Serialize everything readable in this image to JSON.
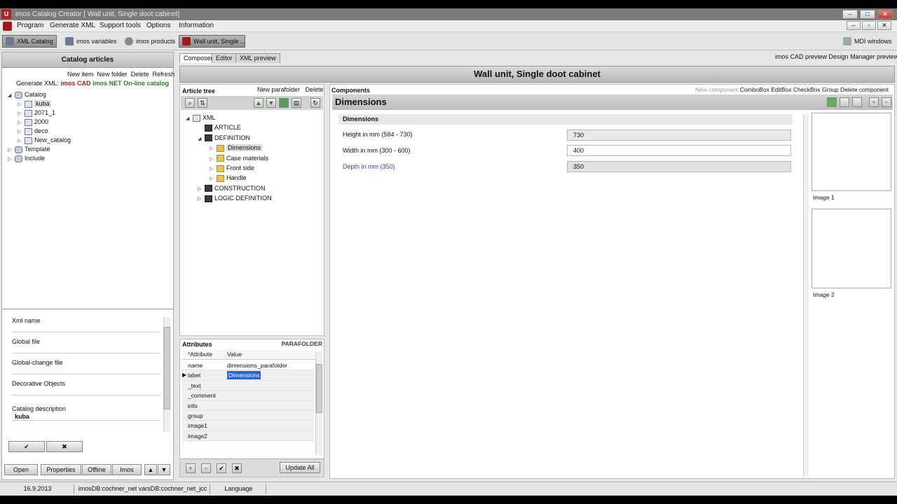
{
  "window": {
    "title": "imos Catalog Creator [ Wall unit, Single doot cabinet]",
    "icon_text": "U",
    "buttons": [
      "–",
      "□",
      "✕"
    ]
  },
  "menubar": {
    "items": [
      "Program",
      "Generate XML",
      "Support tools",
      "Options",
      "Information"
    ],
    "mdi_buttons": [
      "–",
      "▫",
      "✕"
    ]
  },
  "toolbar": {
    "buttons": [
      "XML Catalog",
      "imos variables",
      "imos products"
    ],
    "doc_tab": "Wall unit, Single ...",
    "mdi_windows": "MDI windows"
  },
  "left": {
    "header": "Catalog articles",
    "actions": [
      "New item",
      "New folder",
      "Delete",
      "Refresh"
    ],
    "generate_label": "Generate XML:",
    "generate_targets": [
      "imos CAD",
      "imos NET",
      "On-line catalog"
    ],
    "tree": [
      {
        "label": "Catalog",
        "level": 0,
        "icon": "db",
        "exp": "◢"
      },
      {
        "label": "kuba",
        "level": 1,
        "icon": "xml",
        "exp": "▷",
        "selected": true
      },
      {
        "label": "2071_1",
        "level": 1,
        "icon": "xml",
        "exp": "▷"
      },
      {
        "label": "2000",
        "level": 1,
        "icon": "xml",
        "exp": "▷"
      },
      {
        "label": "deco",
        "level": 1,
        "icon": "xml",
        "exp": "▷"
      },
      {
        "label": "New_catalog",
        "level": 1,
        "icon": "xml",
        "exp": "▷"
      },
      {
        "label": "Template",
        "level": 0,
        "icon": "db",
        "exp": "▷"
      },
      {
        "label": "Include",
        "level": 0,
        "icon": "db",
        "exp": "▷"
      }
    ],
    "props": {
      "xml_name": "Xml name",
      "global_file": "Global file",
      "global_change_file": "Global-change file",
      "decorative_objects": "Decorative Objects",
      "catalog_description": "Catalog description",
      "catalog_description_value": "kuba"
    },
    "ok": "✔",
    "cancel": "✖",
    "bottom_buttons": [
      "Open",
      "Properties",
      "Offline",
      "Imos"
    ]
  },
  "center_tabs": [
    "Composer",
    "Editor",
    "XML preview"
  ],
  "right_links": [
    "imos CAD preview",
    "Design Manager preview"
  ],
  "banner_title": "Wall unit, Single doot cabinet",
  "article_tree": {
    "title": "Article tree",
    "actions": [
      "New parafolder",
      "Delete"
    ],
    "nodes": [
      {
        "label": "XML",
        "level": 0,
        "exp": "◢",
        "icon": "xml"
      },
      {
        "label": "ARTICLE",
        "level": 1,
        "exp": "",
        "icon": "dark"
      },
      {
        "label": "DEFINITION",
        "level": 1,
        "exp": "◢",
        "icon": "dark"
      },
      {
        "label": "Dimensions",
        "level": 2,
        "exp": "▷",
        "icon": "fold",
        "selected": true
      },
      {
        "label": "Case materials",
        "level": 2,
        "exp": "▷",
        "icon": "fold"
      },
      {
        "label": "Front side",
        "level": 2,
        "exp": "▷",
        "icon": "fold"
      },
      {
        "label": "Handle",
        "level": 2,
        "exp": "▷",
        "icon": "fold"
      },
      {
        "label": "CONSTRUCTION",
        "level": 1,
        "exp": "▷",
        "icon": "dark"
      },
      {
        "label": "LOGIC DEFINITION",
        "level": 1,
        "exp": "▷",
        "icon": "dark"
      }
    ]
  },
  "attributes": {
    "title": "Attributes",
    "type": "PARAFOLDER",
    "col_attr": "*Attribute",
    "col_value": "Value",
    "rows": [
      {
        "attr": "name",
        "value": "dimensions_parafolder"
      },
      {
        "attr": "label",
        "value": "Dimensions",
        "selected": true
      },
      {
        "attr": "_text",
        "value": ""
      },
      {
        "attr": "_comment",
        "value": ""
      },
      {
        "attr": "info",
        "value": ""
      },
      {
        "attr": "group",
        "value": ""
      },
      {
        "attr": "image1",
        "value": ""
      },
      {
        "attr": "image2",
        "value": ""
      }
    ],
    "update_all": "Update All"
  },
  "components": {
    "title": "Components",
    "actions": [
      "New component",
      "ComboBox",
      "EditBox",
      "CheckBox",
      "Group",
      "Delete component"
    ],
    "section_title": "Dimensions",
    "group_title": "Dimensions",
    "fields": [
      {
        "label": "Height in mm (584 - 730)",
        "value": "730"
      },
      {
        "label": "Width in mm (300 - 600)",
        "value": "400"
      },
      {
        "label": "Depth in mm (350)",
        "value": "350"
      }
    ],
    "image_labels": [
      "Image 1",
      "Image 2"
    ]
  },
  "statusbar": {
    "date": "16.9.2013",
    "db": "imosDB:cochner_net  varsDB:cochner_net_jcc",
    "language": "Language"
  },
  "colors": {
    "accent_green": "#2a7a2a",
    "accent_red": "#a01818",
    "highlight_blue": "#2a64c8"
  }
}
